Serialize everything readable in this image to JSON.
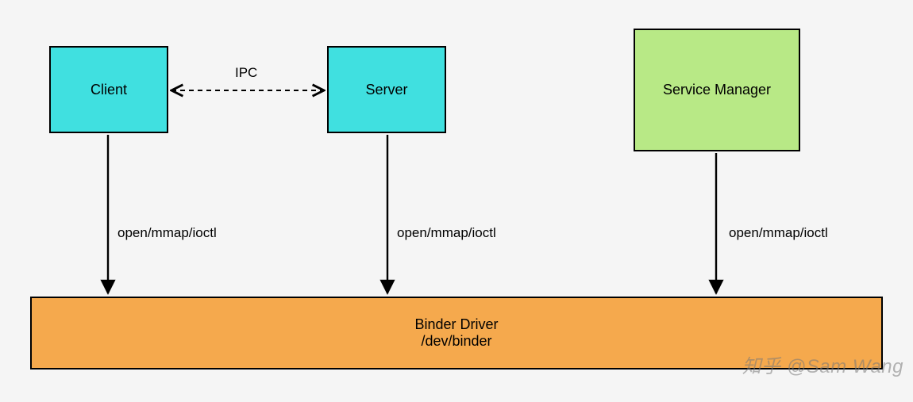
{
  "nodes": {
    "client": "Client",
    "server": "Server",
    "service_manager": "Service Manager",
    "driver_line1": "Binder Driver",
    "driver_line2": "/dev/binder"
  },
  "edges": {
    "ipc": "IPC",
    "client_to_driver": "open/mmap/ioctl",
    "server_to_driver": "open/mmap/ioctl",
    "sm_to_driver": "open/mmap/ioctl"
  },
  "watermark": "知乎 @Sam Wang"
}
